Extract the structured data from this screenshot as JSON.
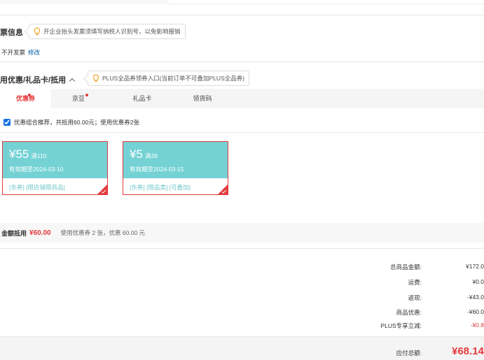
{
  "invoice": {
    "title": "票信息",
    "tip": "开企业抬头发票须填写纳税人识别号，以免影响报销",
    "status": "不开发票",
    "modify": "修改"
  },
  "discount": {
    "title": "用优惠/礼品卡/抵用",
    "tip": "PLUS全品券领券入口(当前订单不可叠加PLUS全品券)",
    "tabs": [
      "优惠券",
      "京豆",
      "礼品卡",
      "领货码"
    ],
    "combo_text": "优惠组合推荐，共抵用60.00元；使用优惠券2张",
    "coupons": [
      {
        "amount": "¥55",
        "limit": "满110",
        "valid": "有效期至2024-03-10",
        "tags": "[东券] [限店铺限商品]"
      },
      {
        "amount": "¥5",
        "limit": "满39",
        "valid": "有效期至2024-03-15",
        "tags": "[东券] [限品类] [可叠加]"
      }
    ],
    "deduct_label": "金额抵用",
    "deduct_value": "¥60.00",
    "deduct_desc": "使用优惠券 2 张，优惠 60.00 元"
  },
  "summary": {
    "rows": [
      {
        "label": "总商品金额:",
        "value": "¥172.0"
      },
      {
        "label": "运费:",
        "value": "¥0.0"
      },
      {
        "label": "返现:",
        "value": "-¥43.0"
      },
      {
        "label": "商品优惠:",
        "value": "-¥60.0"
      },
      {
        "label": "PLUS专享立减:",
        "value": "-¥0.8"
      }
    ],
    "pay_label": "应付总额:",
    "pay_value": "¥68.14"
  },
  "colors": {
    "accent": "#e4393c",
    "coupon": "#74d2d4",
    "link": "#005aa0"
  },
  "icons": {
    "tip": "lightbulb-icon",
    "expand": "chevron-up-icon",
    "selected": "checkmark-icon"
  }
}
